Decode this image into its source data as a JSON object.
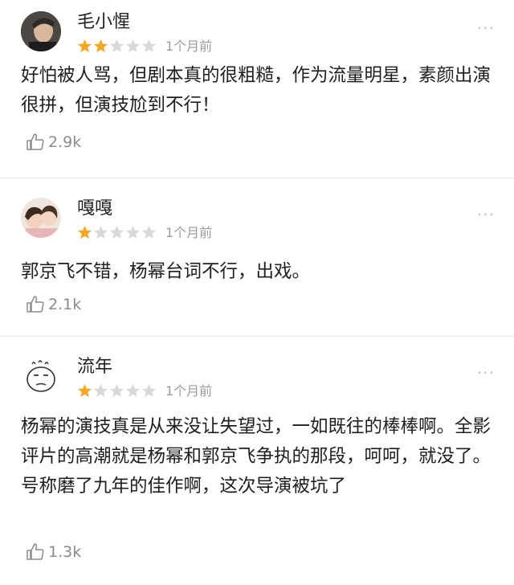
{
  "reviews": [
    {
      "user": "毛小惺",
      "stars": 2,
      "max_stars": 5,
      "time": "1个月前",
      "text": "好怕被人骂，但剧本真的很粗糙，作为流量明星，素颜出演很拼，但演技尬到不行！",
      "likes": "2.9k",
      "avatar": "man-portrait-icon"
    },
    {
      "user": "嘎嘎",
      "stars": 1,
      "max_stars": 5,
      "time": "1个月前",
      "text": "郭京飞不错，杨幂台词不行，出戏。",
      "likes": "2.1k",
      "avatar": "two-children-icon"
    },
    {
      "user": "流年",
      "stars": 1,
      "max_stars": 5,
      "time": "1个月前",
      "text": "杨幂的演技真是从来没让失望过，一如既往的棒棒啊。全影评片的高潮就是杨幂和郭京飞争执的那段，呵呵，就没了。号称磨了九年的佳作啊，这次导演被坑了",
      "likes": "1.3k",
      "avatar": "doodle-face-icon"
    }
  ],
  "more_label": "···",
  "colors": {
    "star_on": "#f5a623",
    "star_off": "#d8d8d8"
  }
}
